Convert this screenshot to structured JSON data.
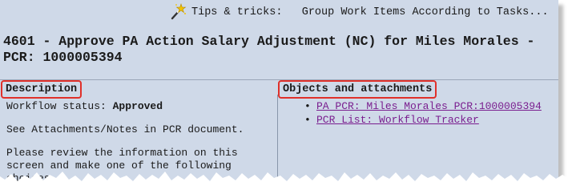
{
  "tips": {
    "icon": "magic-wand-icon",
    "text": "Tips & tricks:   Group Work Items According to Tasks..."
  },
  "title": {
    "line1": "4601 - Approve PA Action Salary Adjustment (NC) for Miles Morales -",
    "line2": "PCR: 1000005394"
  },
  "description": {
    "header": "Description",
    "status_label": "Workflow status: ",
    "status_value": "Approved",
    "note": "See Attachments/Notes in PCR document.",
    "instructions": "Please review the information on this screen and make one of the following choices"
  },
  "objects": {
    "header": "Objects and attachments",
    "links": [
      {
        "label": "PA PCR: Miles Morales PCR:1000005394"
      },
      {
        "label": "PCR List: Workflow Tracker"
      }
    ]
  },
  "colors": {
    "panel": "#cfd9e8",
    "highlight_border": "#e0302a",
    "link": "#7a1e8f"
  }
}
